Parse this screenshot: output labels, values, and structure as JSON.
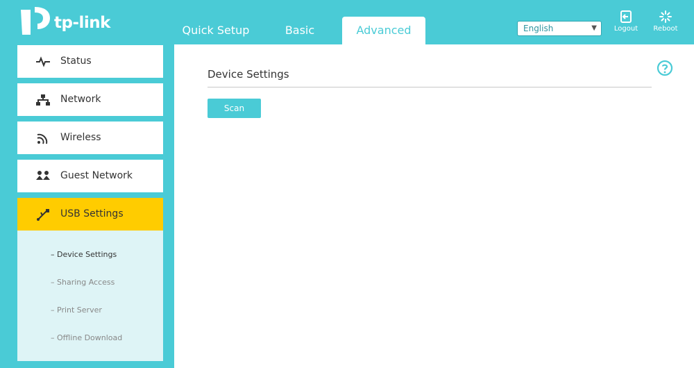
{
  "brand": {
    "name": "tp-link"
  },
  "header": {
    "tabs": [
      {
        "label": "Quick Setup"
      },
      {
        "label": "Basic"
      },
      {
        "label": "Advanced",
        "active": true
      }
    ],
    "language": {
      "selected": "English"
    },
    "logout_label": "Logout",
    "reboot_label": "Reboot"
  },
  "sidebar": {
    "items": [
      {
        "label": "Status",
        "icon": "pulse-icon"
      },
      {
        "label": "Network",
        "icon": "network-icon"
      },
      {
        "label": "Wireless",
        "icon": "wifi-icon"
      },
      {
        "label": "Guest Network",
        "icon": "guest-icon"
      },
      {
        "label": "USB Settings",
        "icon": "usb-icon",
        "active": true
      }
    ],
    "submenu": [
      {
        "label": "Device Settings",
        "current": true
      },
      {
        "label": "Sharing Access"
      },
      {
        "label": "Print Server"
      },
      {
        "label": "Offline Download"
      }
    ]
  },
  "main": {
    "title": "Device Settings",
    "scan_label": "Scan"
  },
  "colors": {
    "accent": "#4acbd6",
    "active_menu": "#ffcc00",
    "submenu_bg": "#def4f6"
  }
}
